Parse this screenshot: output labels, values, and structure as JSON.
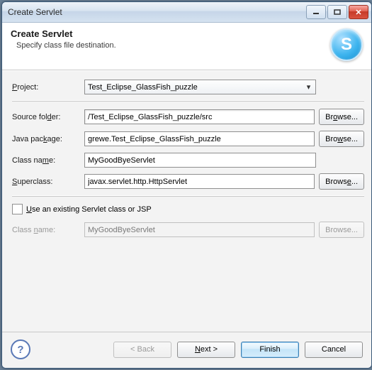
{
  "window": {
    "title": "Create Servlet"
  },
  "banner": {
    "heading": "Create Servlet",
    "sub": "Specify class file destination."
  },
  "labels": {
    "project": "Project:",
    "sourceFolder": "Source folder:",
    "javaPackage": "Java package:",
    "className": "Class name:",
    "superclass": "Superclass:",
    "useExisting": "Use an existing Servlet class or JSP",
    "className2": "Class name:"
  },
  "values": {
    "project": "Test_Eclipse_GlassFish_puzzle",
    "sourceFolder": "/Test_Eclipse_GlassFish_puzzle/src",
    "javaPackage": "grewe.Test_Eclipse_GlassFish_puzzle",
    "className": "MyGoodByeServlet",
    "superclass": "javax.servlet.http.HttpServlet",
    "className2": "MyGoodByeServlet"
  },
  "buttons": {
    "browse": "Browse...",
    "back": "< Back",
    "next": "Next >",
    "finish": "Finish",
    "cancel": "Cancel"
  },
  "mnemonic": {
    "next": "N",
    "use": "U",
    "className2": "n"
  }
}
